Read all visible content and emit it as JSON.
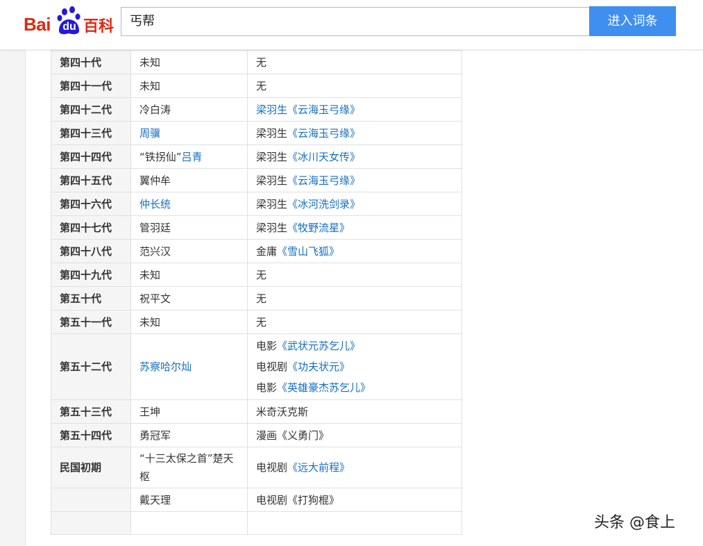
{
  "header": {
    "logo_bai": "Bai",
    "logo_du": "du",
    "logo_baike": "百科",
    "search_value": "丐帮",
    "enter_button": "进入词条"
  },
  "rows": [
    {
      "gen": "第四十代",
      "name": [
        {
          "t": "未知"
        }
      ],
      "source": [
        [
          {
            "t": "无"
          }
        ]
      ]
    },
    {
      "gen": "第四十一代",
      "name": [
        {
          "t": "未知"
        }
      ],
      "source": [
        [
          {
            "t": "无"
          }
        ]
      ]
    },
    {
      "gen": "第四十二代",
      "name": [
        {
          "t": "冷白涛"
        }
      ],
      "source": [
        [
          {
            "t": "梁羽生《云海玉弓缘》",
            "link": true
          }
        ]
      ]
    },
    {
      "gen": "第四十三代",
      "name": [
        {
          "t": "周骥",
          "link": true
        }
      ],
      "source": [
        [
          {
            "t": "梁羽生"
          },
          {
            "t": "《云海玉弓缘》",
            "link": true
          }
        ]
      ]
    },
    {
      "gen": "第四十四代",
      "name": [
        {
          "t": "“铁拐仙”"
        },
        {
          "t": "吕青",
          "link": true
        }
      ],
      "source": [
        [
          {
            "t": "梁羽生"
          },
          {
            "t": "《冰川天女传》",
            "link": true
          }
        ]
      ]
    },
    {
      "gen": "第四十五代",
      "name": [
        {
          "t": "翼仲牟"
        }
      ],
      "source": [
        [
          {
            "t": "梁羽生"
          },
          {
            "t": "《云海玉弓缘》",
            "link": true
          }
        ]
      ]
    },
    {
      "gen": "第四十六代",
      "name": [
        {
          "t": "仲长统",
          "link": true
        }
      ],
      "source": [
        [
          {
            "t": "梁羽生"
          },
          {
            "t": "《冰河洗剑录》",
            "link": true
          }
        ]
      ]
    },
    {
      "gen": "第四十七代",
      "name": [
        {
          "t": "管羽廷"
        }
      ],
      "source": [
        [
          {
            "t": "梁羽生"
          },
          {
            "t": "《牧野流星》",
            "link": true
          }
        ]
      ]
    },
    {
      "gen": "第四十八代",
      "name": [
        {
          "t": "范兴汉"
        }
      ],
      "source": [
        [
          {
            "t": "金庸"
          },
          {
            "t": "《雪山飞狐》",
            "link": true
          }
        ]
      ]
    },
    {
      "gen": "第四十九代",
      "name": [
        {
          "t": "未知"
        }
      ],
      "source": [
        [
          {
            "t": "无"
          }
        ]
      ]
    },
    {
      "gen": "第五十代",
      "name": [
        {
          "t": "祝平文"
        }
      ],
      "source": [
        [
          {
            "t": "无"
          }
        ]
      ]
    },
    {
      "gen": "第五十一代",
      "name": [
        {
          "t": "未知"
        }
      ],
      "source": [
        [
          {
            "t": "无"
          }
        ]
      ]
    },
    {
      "gen": "第五十二代",
      "name": [
        {
          "t": "苏察哈尔灿",
          "link": true
        }
      ],
      "source": [
        [
          {
            "t": "电影"
          },
          {
            "t": "《武状元苏乞儿》",
            "link": true
          }
        ],
        [
          {
            "t": "电视剧"
          },
          {
            "t": "《功夫状元》",
            "link": true
          }
        ],
        [
          {
            "t": "电影"
          },
          {
            "t": "《英雄豪杰苏乞儿》",
            "link": true
          }
        ]
      ]
    },
    {
      "gen": "第五十三代",
      "name": [
        {
          "t": "王坤"
        }
      ],
      "source": [
        [
          {
            "t": "米奇沃克斯"
          }
        ]
      ]
    },
    {
      "gen": "第五十四代",
      "name": [
        {
          "t": "勇冠军"
        }
      ],
      "source": [
        [
          {
            "t": "漫画《义勇门》"
          }
        ]
      ]
    },
    {
      "gen": "民国初期",
      "name": [
        {
          "t": "“十三太保之首”楚天枢"
        }
      ],
      "source": [
        [
          {
            "t": "电视剧"
          },
          {
            "t": "《远大前程》",
            "link": true
          }
        ]
      ]
    },
    {
      "gen": "",
      "name": [
        {
          "t": "戴天理"
        }
      ],
      "source": [
        [
          {
            "t": "电视剧《打狗棍》"
          }
        ]
      ]
    },
    {
      "gen": "",
      "name": [],
      "source": [
        []
      ]
    }
  ],
  "watermark": "头条 @食上",
  "colors": {
    "link": "#136ec2",
    "button": "#3f8fef",
    "logo_red": "#de2910",
    "logo_blue": "#2319dc"
  }
}
